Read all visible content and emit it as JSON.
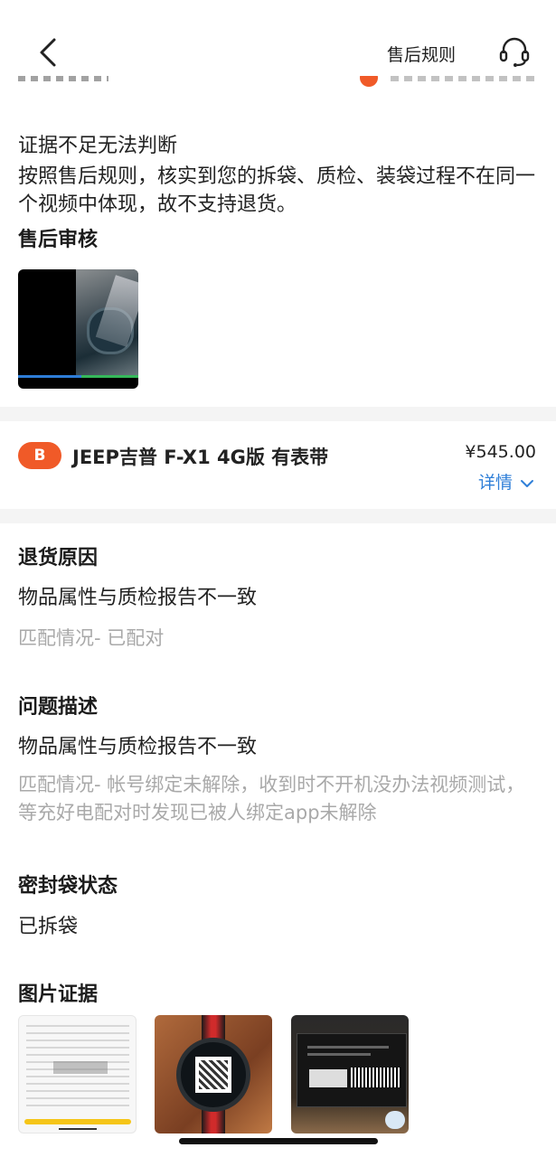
{
  "nav": {
    "rules_label": "售后规则"
  },
  "verdict": {
    "title": "证据不足无法判断",
    "desc": "按照售后规则，核实到您的拆袋、质检、装袋过程不在同一个视频中体现，故不支持退货。",
    "review_label": "售后审核"
  },
  "product": {
    "badge": "B",
    "name": "JEEP吉普 F-X1 4G版 有表带",
    "price": "¥545.00",
    "detail_label": "详情"
  },
  "return_reason": {
    "label": "退货原因",
    "value": "物品属性与质检报告不一致",
    "match": "匹配情况- 已配对"
  },
  "issue": {
    "label": "问题描述",
    "value": "物品属性与质检报告不一致",
    "match": "匹配情况- 帐号绑定未解除，收到时不开机没办法视频测试，等充好电配对时发现已被人绑定app未解除"
  },
  "seal": {
    "label": "密封袋状态",
    "value": "已拆袋"
  },
  "photos": {
    "label": "图片证据"
  },
  "colors": {
    "accent": "#f05a28",
    "link": "#2f7fd8",
    "muted": "#a9a9a9",
    "divider": "#f4f4f4"
  }
}
